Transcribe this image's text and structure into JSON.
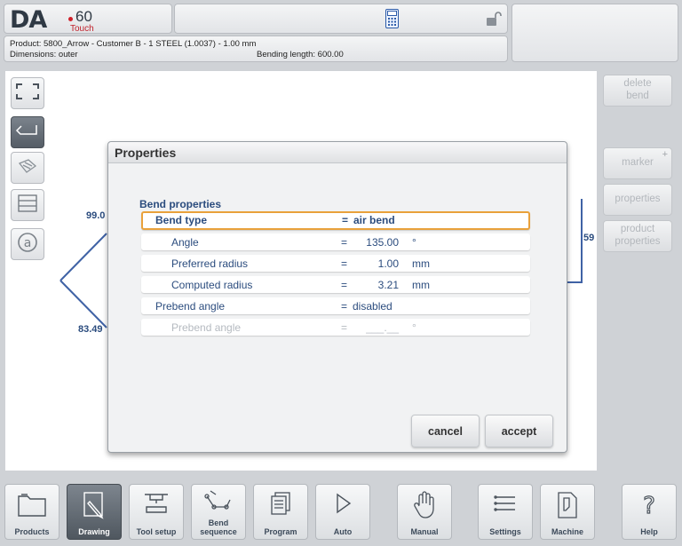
{
  "logo": {
    "brand": "DA",
    "model": "60",
    "sub": "Touch"
  },
  "header": {
    "product_line": "Product: 5800_Arrow - Customer B - 1 STEEL (1.0037) - 1.00 mm",
    "dimensions": "Dimensions: outer",
    "bending_length": "Bending length: 600.00"
  },
  "right_buttons": {
    "delete_bend": "delete\nbend",
    "marker": "marker",
    "marker_plus": "+",
    "properties": "properties",
    "product_properties": "product\nproperties"
  },
  "drawing": {
    "dim_top": "99.0",
    "dim_bottom": "83.49",
    "dim_right": "59"
  },
  "dialog": {
    "title": "Properties",
    "section": "Bend properties",
    "rows": [
      {
        "label": "Bend type",
        "eq": "=",
        "value": "air bend",
        "unit": ""
      },
      {
        "label": "Angle",
        "eq": "=",
        "value": "135.00",
        "unit": "°"
      },
      {
        "label": "Preferred radius",
        "eq": "=",
        "value": "1.00",
        "unit": "mm"
      },
      {
        "label": "Computed radius",
        "eq": "=",
        "value": "3.21",
        "unit": "mm"
      },
      {
        "label": "Prebend angle",
        "eq": "=",
        "value": "disabled",
        "unit": ""
      },
      {
        "label": "Prebend angle",
        "eq": "=",
        "value": "___.__",
        "unit": "°"
      }
    ],
    "cancel": "cancel",
    "accept": "accept"
  },
  "nav": {
    "products": "Products",
    "drawing": "Drawing",
    "tool_setup": "Tool setup",
    "bend_sequence": "Bend\nsequence",
    "program": "Program",
    "auto": "Auto",
    "manual": "Manual",
    "settings": "Settings",
    "machine": "Machine",
    "help": "Help"
  },
  "colors": {
    "accent": "#2b4c7e",
    "selection": "#e9a13b",
    "brand_red": "#d0202a"
  },
  "icons": [
    "calculator-icon",
    "unlock-icon",
    "select-area-icon",
    "bend-icon",
    "bend-property-icon",
    "hatch-icon",
    "at-icon"
  ]
}
